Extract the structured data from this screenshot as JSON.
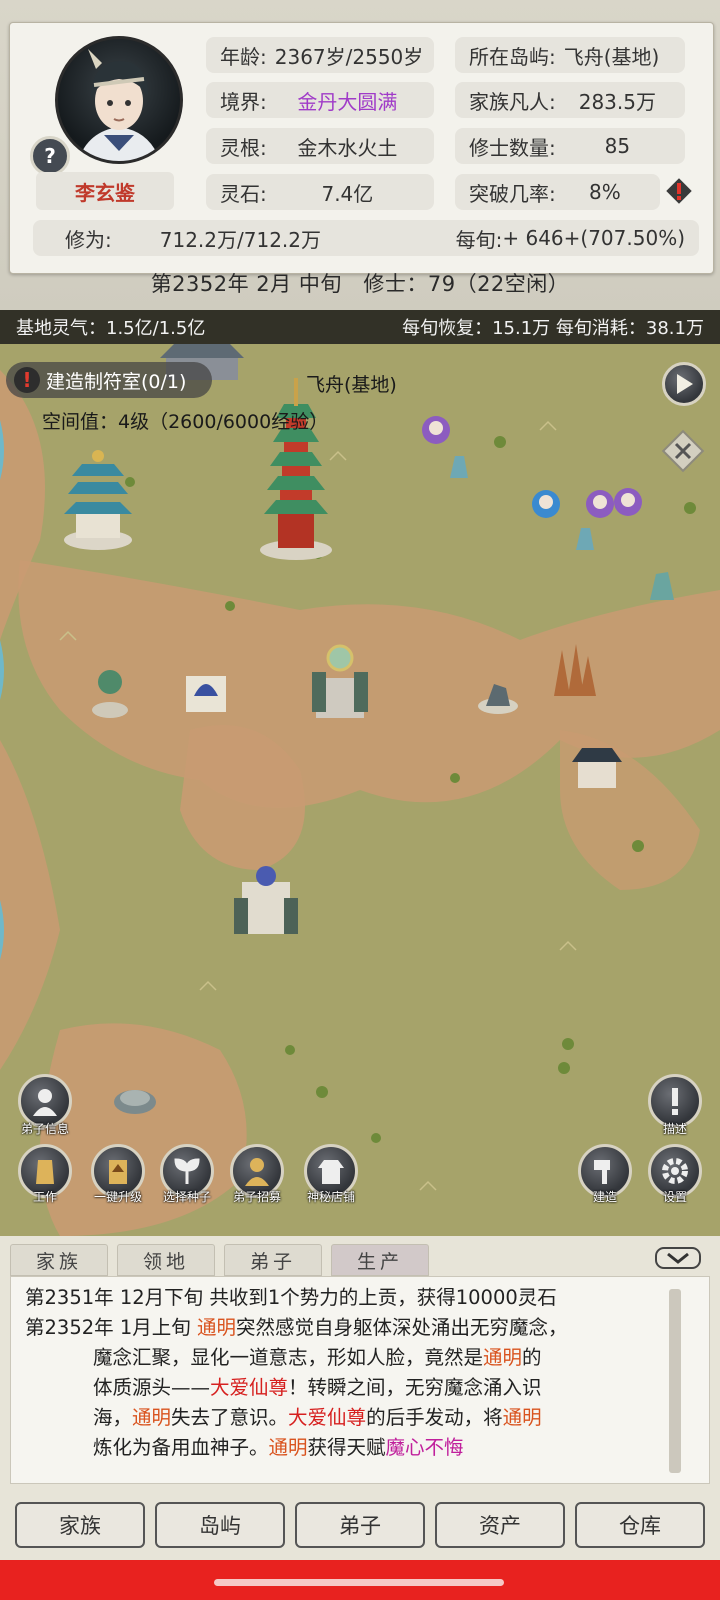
{
  "player": {
    "name": "李玄鉴",
    "age_label": "年龄:",
    "age_value": "2367岁/2550岁",
    "realm_label": "境界:",
    "realm_value": "金丹大圆满",
    "root_label": "灵根:",
    "root_value": "金木水火土",
    "stones_label": "灵石:",
    "stones_value": "7.4亿",
    "cultivation_label": "修为:",
    "cultivation_value": "712.2万/712.2万",
    "island_label": "所在岛屿:",
    "island_value": "飞舟(基地)",
    "mortals_label": "家族凡人:",
    "mortals_value": "283.5万",
    "cultivators_label": "修士数量:",
    "cultivators_value": "85",
    "breakthrough_label": "突破几率:",
    "breakthrough_value": "8%",
    "per_xun_label": "每旬:",
    "per_xun_value": "+ 646+(707.50%)"
  },
  "date_line": "第2352年 2月 中旬　修士：79（22空闲）",
  "map": {
    "qi_left": "基地灵气：1.5亿/1.5亿",
    "qi_right": "每旬恢复：15.1万 每旬消耗：38.1万",
    "location_name": "飞舟(基地)",
    "build_quest": "建造制符室(0/1)",
    "space_value": "空间值：4级（2600/6000经验）",
    "buttons": {
      "disciple_info": "弟子信息",
      "work": "工作",
      "upgrade_all": "一键升级",
      "choose_seed": "选择种子",
      "recruit": "弟子招募",
      "shop": "神秘店铺",
      "describe": "描述",
      "build": "建造",
      "settings": "设置"
    }
  },
  "tabs": [
    "家族",
    "领地",
    "弟子",
    "生产"
  ],
  "active_tab": "生产",
  "log": {
    "line1": "第2351年 12月下旬 共收到1个势力的上贡，获得10000灵石",
    "line2_prefix": "第2352年 1月上旬 ",
    "name_a": "通明",
    "name_b": "大爱仙尊",
    "talent": "魔心不悔",
    "t1": "突然感觉自身躯体深处涌出无穷魔念，",
    "t2": "魔念汇聚，显化一道意志，形如人脸，竟然是",
    "t3": "的",
    "t4": "体质源头——",
    "t5": "！转瞬之间，无穷魔念涌入识",
    "t6": "海，",
    "t7": "失去了意识。",
    "t8": "的后手发动，将",
    "t9": "炼化为备用血神子。",
    "t10": "获得天赋"
  },
  "nav": [
    "家族",
    "岛屿",
    "弟子",
    "资产",
    "仓库"
  ],
  "colors": {
    "accent_red": "#d6201f",
    "name_orange": "#d9531e",
    "realm_purple": "#a03bc8",
    "nav_strip": "#e8221f"
  }
}
